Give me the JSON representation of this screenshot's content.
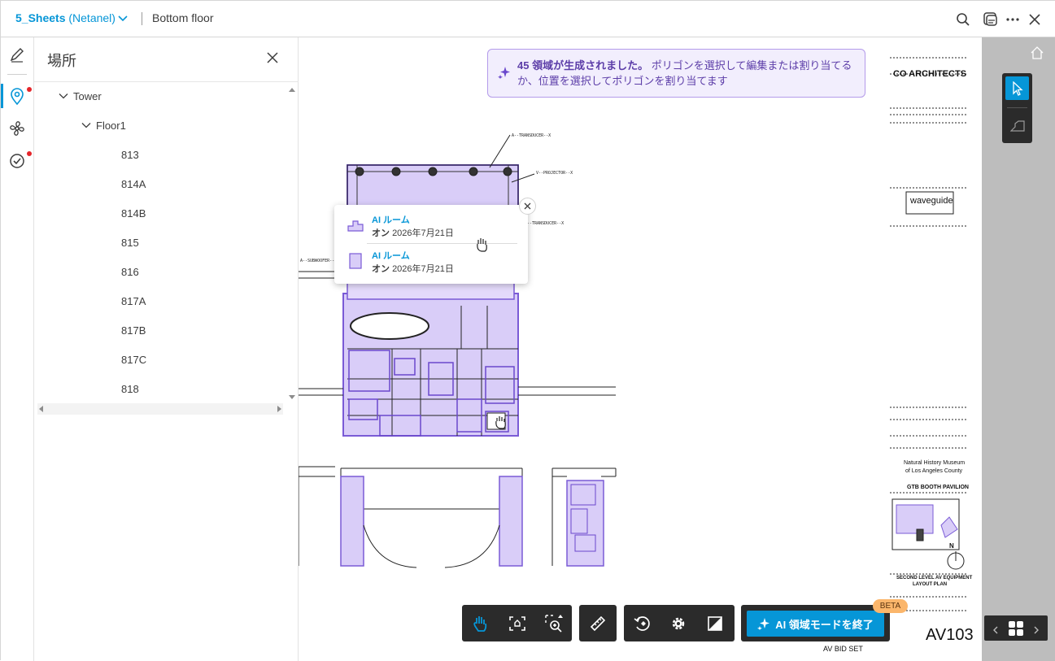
{
  "header": {
    "project_name": "5_Sheets",
    "project_owner": "(Netanel)",
    "sheet_name": "Bottom floor",
    "icons": [
      "search-icon",
      "compare-icon",
      "more-icon",
      "close-icon"
    ]
  },
  "rail": {
    "items": [
      "markup-icon",
      "location-icon",
      "hvac-icon",
      "check-icon"
    ],
    "active": "location-icon"
  },
  "panel": {
    "title": "場所",
    "tree": {
      "root": "Tower",
      "child": "Floor1",
      "rooms": [
        "813",
        "814A",
        "814B",
        "815",
        "816",
        "817A",
        "817B",
        "817C",
        "818"
      ]
    }
  },
  "banner": {
    "count_text": "45 領域が生成されました。",
    "message_line1": "ポリゴンを選択して編集または割り当てる",
    "message_line2": "か、位置を選択してポリゴンを割り当てます"
  },
  "popup": {
    "items": [
      {
        "title": "AI ルーム",
        "prefix": "オン",
        "date": "2026年7月21日"
      },
      {
        "title": "AI ルーム",
        "prefix": "オン",
        "date": "2026年7月21日"
      }
    ]
  },
  "titleblock": {
    "firm": "CO ARCHITECTS",
    "consultant": "waveguide",
    "project_line1": "Natural History Museum",
    "project_line2": "of Los Angeles County",
    "project_line3": "GTB BOOTH PAVILION",
    "sheet_title_line1": "SECOND LEVEL AV EQUIPMENT",
    "sheet_title_line2": "LAYOUT PLAN",
    "sheet_number": "AV103",
    "footer": "AV  BID  SET",
    "north": "N"
  },
  "drawing_notes": {
    "note_a": "A--TRANSDUCER--X",
    "note_b": "V--PROJECTOR--X",
    "note_c": "A--SUBWOOFER--X"
  },
  "toolbar": {
    "tools": [
      "pan-icon",
      "fit-icon",
      "zoom-area-icon",
      "measure-icon",
      "rotate-icon",
      "settings-icon",
      "fullscreen-icon"
    ],
    "ai_button": "AI 領域モードを終了",
    "beta": "BETA"
  },
  "colors": {
    "accent": "#0696d7",
    "region_fill": "#cfc2f5",
    "region_stroke": "#7a5bd6",
    "banner_bg": "#f2eefd",
    "toolbar_bg": "#2b2b2b",
    "alert_dot": "#e5252a",
    "beta_bg": "#fbb66b"
  }
}
